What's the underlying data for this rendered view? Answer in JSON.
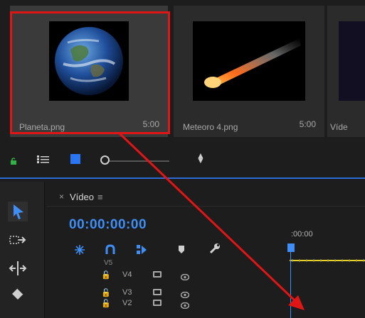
{
  "media_bin": {
    "clips": [
      {
        "name": "Planeta.png",
        "duration": "5:00",
        "thumb_icon": "earth-thumbnail"
      },
      {
        "name": "Meteoro 4.png",
        "duration": "5:00",
        "thumb_icon": "meteor-thumbnail"
      },
      {
        "name": "Víde",
        "thumb_icon": "video-thumbnail"
      }
    ],
    "selection_color": "#e01515"
  },
  "bin_toolbar": {
    "icons": [
      "lock-icon",
      "list-view-icon",
      "icon-view-icon",
      "zoom-slider",
      "sort-icon"
    ]
  },
  "tools": [
    "selection-tool-icon",
    "track-select-tool-icon",
    "ripple-edit-tool-icon",
    "razor-tool-icon"
  ],
  "sequence": {
    "name": "Vídeo",
    "close_glyph": "×",
    "menu_glyph": "≡",
    "timecode": "00:00:00:00",
    "ruler_label": ":00:00",
    "tracks": [
      {
        "label": "V5"
      },
      {
        "label": "V4"
      },
      {
        "label": "V3"
      },
      {
        "label": "V2"
      }
    ]
  },
  "colors": {
    "accent_blue": "#3f8ef5",
    "ruler_yellow": "#e7d31d",
    "annotation_red": "#e01515",
    "lock_green": "#2fb344"
  }
}
